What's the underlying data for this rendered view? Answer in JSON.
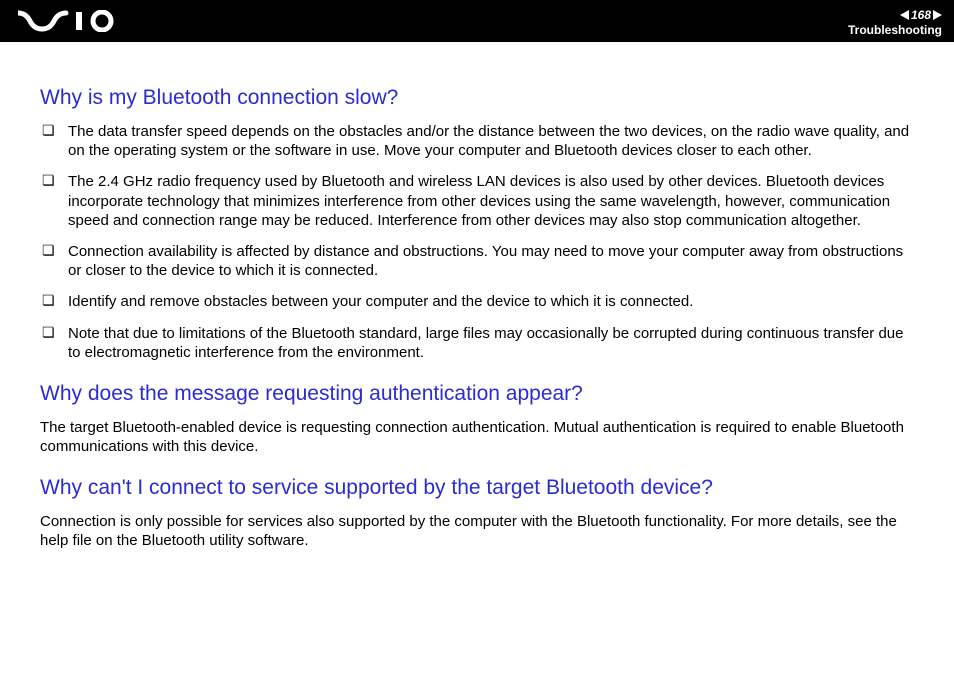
{
  "header": {
    "page_number": "168",
    "section": "Troubleshooting"
  },
  "sections": [
    {
      "heading": "Why is my Bluetooth connection slow?",
      "bullets": [
        "The data transfer speed depends on the obstacles and/or the distance between the two devices, on the radio wave quality, and on the operating system or the software in use. Move your computer and Bluetooth devices closer to each other.",
        "The 2.4 GHz radio frequency used by Bluetooth and wireless LAN devices is also used by other devices. Bluetooth devices incorporate technology that minimizes interference from other devices using the same wavelength, however, communication speed and connection range may be reduced. Interference from other devices may also stop communication altogether.",
        "Connection availability is affected by distance and obstructions. You may need to move your computer away from obstructions or closer to the device to which it is connected.",
        "Identify and remove obstacles between your computer and the device to which it is connected.",
        "Note that due to limitations of the Bluetooth standard, large files may occasionally be corrupted during continuous transfer due to electromagnetic interference from the environment."
      ]
    },
    {
      "heading": "Why does the message requesting authentication appear?",
      "para": "The target Bluetooth-enabled device is requesting connection authentication. Mutual authentication is required to enable Bluetooth communications with this device."
    },
    {
      "heading": "Why can't I connect to service supported by the target Bluetooth device?",
      "para": "Connection is only possible for services also supported by the computer with the Bluetooth functionality. For more details, see the help file on the Bluetooth utility software."
    }
  ]
}
